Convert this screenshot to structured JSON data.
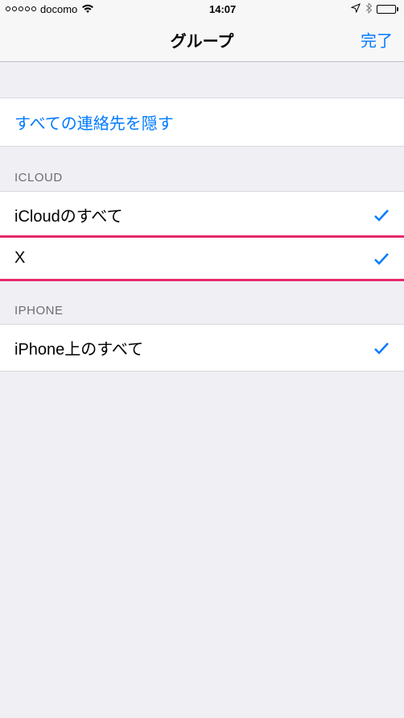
{
  "status_bar": {
    "carrier": "docomo",
    "time": "14:07"
  },
  "nav": {
    "title": "グループ",
    "done": "完了"
  },
  "hide_all": "すべての連絡先を隠す",
  "sections": {
    "icloud": {
      "header": "ICLOUD",
      "items": [
        {
          "label": "iCloudのすべて"
        },
        {
          "label": "X"
        }
      ]
    },
    "iphone": {
      "header": "IPHONE",
      "items": [
        {
          "label": "iPhone上のすべて"
        }
      ]
    }
  }
}
